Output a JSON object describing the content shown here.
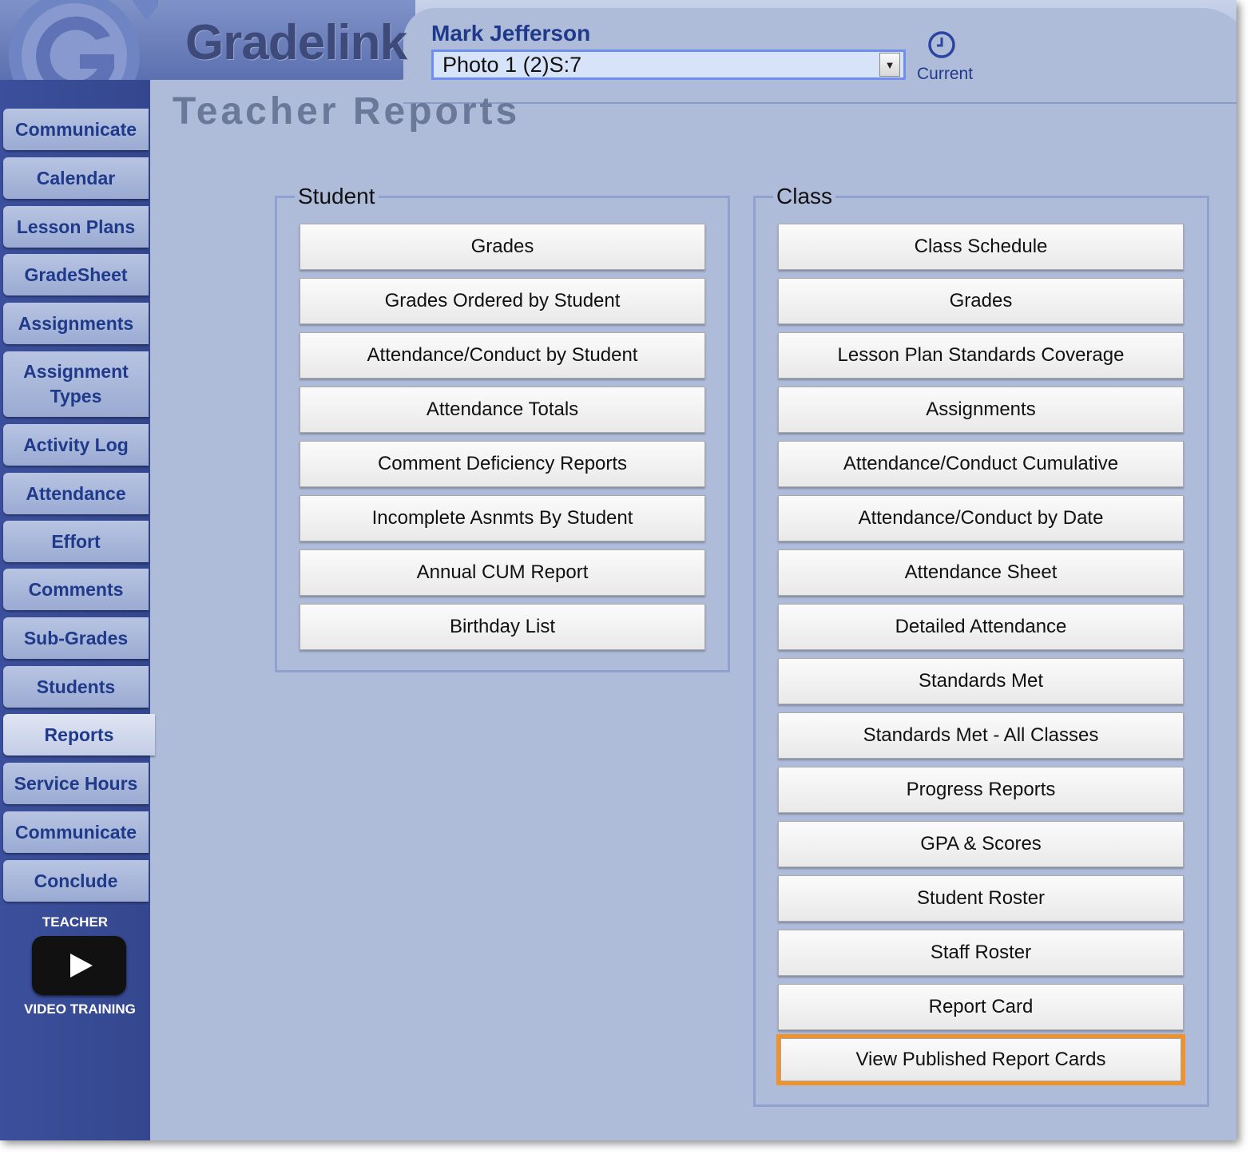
{
  "app": {
    "brand": "Gradelink"
  },
  "header": {
    "user_name": "Mark Jefferson",
    "class_select_value": "Photo 1 (2)S:7",
    "current_label": "Current"
  },
  "page_title": "Teacher Reports",
  "sidebar": {
    "items": [
      {
        "label": "Communicate"
      },
      {
        "label": "Calendar"
      },
      {
        "label": "Lesson Plans"
      },
      {
        "label": "GradeSheet"
      },
      {
        "label": "Assignments"
      },
      {
        "label": "Assignment Types"
      },
      {
        "label": "Activity Log"
      },
      {
        "label": "Attendance"
      },
      {
        "label": "Effort"
      },
      {
        "label": "Comments"
      },
      {
        "label": "Sub-Grades"
      },
      {
        "label": "Students"
      },
      {
        "label": "Reports"
      },
      {
        "label": "Service Hours"
      },
      {
        "label": "Communicate"
      },
      {
        "label": "Conclude"
      }
    ],
    "active": "Reports",
    "video_top": "TEACHER",
    "video_bottom": "VIDEO TRAINING"
  },
  "student_group": {
    "legend": "Student",
    "buttons": [
      "Grades",
      "Grades Ordered by Student",
      "Attendance/Conduct by Student",
      "Attendance Totals",
      "Comment Deficiency Reports",
      "Incomplete Asnmts By Student",
      "Annual CUM Report",
      "Birthday List"
    ]
  },
  "class_group": {
    "legend": "Class",
    "buttons": [
      "Class Schedule",
      "Grades",
      "Lesson Plan Standards Coverage",
      "Assignments",
      "Attendance/Conduct Cumulative",
      "Attendance/Conduct by Date",
      "Attendance Sheet",
      "Detailed Attendance",
      "Standards Met",
      "Standards Met - All Classes",
      "Progress Reports",
      "GPA & Scores",
      "Student Roster",
      "Staff Roster",
      "Report Card",
      "View Published Report Cards"
    ]
  },
  "colors": {
    "sidebar": "#34478e",
    "background": "#aebbd9",
    "highlight": "#f0922b",
    "nav_text": "#1f3a8a"
  }
}
